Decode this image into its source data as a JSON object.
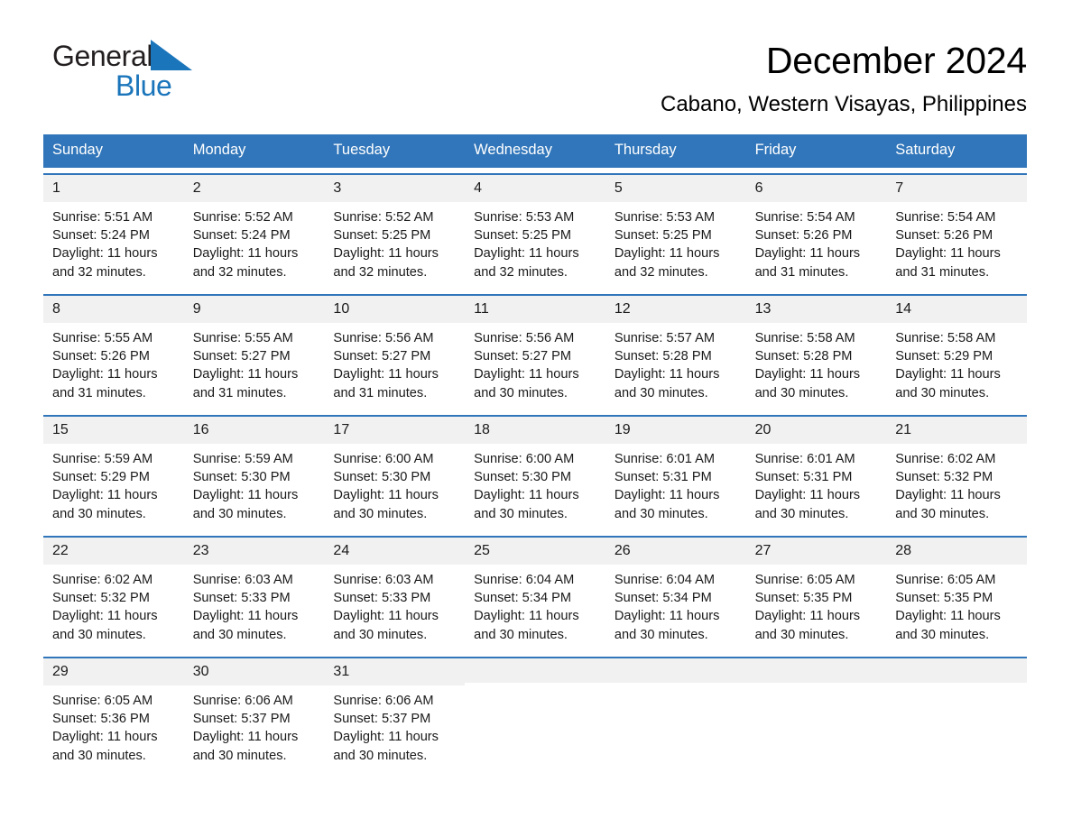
{
  "brand": {
    "name_line1": "General",
    "name_line2": "Blue",
    "accent_color": "#1b75bb",
    "triangle_icon": "triangle-icon"
  },
  "header": {
    "title": "December 2024",
    "subtitle": "Cabano, Western Visayas, Philippines"
  },
  "calendar": {
    "header_bg": "#3176ba",
    "header_text_color": "#ffffff",
    "row_divider_color": "#3176ba",
    "day_number_bg": "#f1f1f1",
    "weekdays": [
      "Sunday",
      "Monday",
      "Tuesday",
      "Wednesday",
      "Thursday",
      "Friday",
      "Saturday"
    ],
    "weeks": [
      [
        {
          "day": "1",
          "sunrise": "Sunrise: 5:51 AM",
          "sunset": "Sunset: 5:24 PM",
          "daylight_l1": "Daylight: 11 hours",
          "daylight_l2": "and 32 minutes."
        },
        {
          "day": "2",
          "sunrise": "Sunrise: 5:52 AM",
          "sunset": "Sunset: 5:24 PM",
          "daylight_l1": "Daylight: 11 hours",
          "daylight_l2": "and 32 minutes."
        },
        {
          "day": "3",
          "sunrise": "Sunrise: 5:52 AM",
          "sunset": "Sunset: 5:25 PM",
          "daylight_l1": "Daylight: 11 hours",
          "daylight_l2": "and 32 minutes."
        },
        {
          "day": "4",
          "sunrise": "Sunrise: 5:53 AM",
          "sunset": "Sunset: 5:25 PM",
          "daylight_l1": "Daylight: 11 hours",
          "daylight_l2": "and 32 minutes."
        },
        {
          "day": "5",
          "sunrise": "Sunrise: 5:53 AM",
          "sunset": "Sunset: 5:25 PM",
          "daylight_l1": "Daylight: 11 hours",
          "daylight_l2": "and 32 minutes."
        },
        {
          "day": "6",
          "sunrise": "Sunrise: 5:54 AM",
          "sunset": "Sunset: 5:26 PM",
          "daylight_l1": "Daylight: 11 hours",
          "daylight_l2": "and 31 minutes."
        },
        {
          "day": "7",
          "sunrise": "Sunrise: 5:54 AM",
          "sunset": "Sunset: 5:26 PM",
          "daylight_l1": "Daylight: 11 hours",
          "daylight_l2": "and 31 minutes."
        }
      ],
      [
        {
          "day": "8",
          "sunrise": "Sunrise: 5:55 AM",
          "sunset": "Sunset: 5:26 PM",
          "daylight_l1": "Daylight: 11 hours",
          "daylight_l2": "and 31 minutes."
        },
        {
          "day": "9",
          "sunrise": "Sunrise: 5:55 AM",
          "sunset": "Sunset: 5:27 PM",
          "daylight_l1": "Daylight: 11 hours",
          "daylight_l2": "and 31 minutes."
        },
        {
          "day": "10",
          "sunrise": "Sunrise: 5:56 AM",
          "sunset": "Sunset: 5:27 PM",
          "daylight_l1": "Daylight: 11 hours",
          "daylight_l2": "and 31 minutes."
        },
        {
          "day": "11",
          "sunrise": "Sunrise: 5:56 AM",
          "sunset": "Sunset: 5:27 PM",
          "daylight_l1": "Daylight: 11 hours",
          "daylight_l2": "and 30 minutes."
        },
        {
          "day": "12",
          "sunrise": "Sunrise: 5:57 AM",
          "sunset": "Sunset: 5:28 PM",
          "daylight_l1": "Daylight: 11 hours",
          "daylight_l2": "and 30 minutes."
        },
        {
          "day": "13",
          "sunrise": "Sunrise: 5:58 AM",
          "sunset": "Sunset: 5:28 PM",
          "daylight_l1": "Daylight: 11 hours",
          "daylight_l2": "and 30 minutes."
        },
        {
          "day": "14",
          "sunrise": "Sunrise: 5:58 AM",
          "sunset": "Sunset: 5:29 PM",
          "daylight_l1": "Daylight: 11 hours",
          "daylight_l2": "and 30 minutes."
        }
      ],
      [
        {
          "day": "15",
          "sunrise": "Sunrise: 5:59 AM",
          "sunset": "Sunset: 5:29 PM",
          "daylight_l1": "Daylight: 11 hours",
          "daylight_l2": "and 30 minutes."
        },
        {
          "day": "16",
          "sunrise": "Sunrise: 5:59 AM",
          "sunset": "Sunset: 5:30 PM",
          "daylight_l1": "Daylight: 11 hours",
          "daylight_l2": "and 30 minutes."
        },
        {
          "day": "17",
          "sunrise": "Sunrise: 6:00 AM",
          "sunset": "Sunset: 5:30 PM",
          "daylight_l1": "Daylight: 11 hours",
          "daylight_l2": "and 30 minutes."
        },
        {
          "day": "18",
          "sunrise": "Sunrise: 6:00 AM",
          "sunset": "Sunset: 5:30 PM",
          "daylight_l1": "Daylight: 11 hours",
          "daylight_l2": "and 30 minutes."
        },
        {
          "day": "19",
          "sunrise": "Sunrise: 6:01 AM",
          "sunset": "Sunset: 5:31 PM",
          "daylight_l1": "Daylight: 11 hours",
          "daylight_l2": "and 30 minutes."
        },
        {
          "day": "20",
          "sunrise": "Sunrise: 6:01 AM",
          "sunset": "Sunset: 5:31 PM",
          "daylight_l1": "Daylight: 11 hours",
          "daylight_l2": "and 30 minutes."
        },
        {
          "day": "21",
          "sunrise": "Sunrise: 6:02 AM",
          "sunset": "Sunset: 5:32 PM",
          "daylight_l1": "Daylight: 11 hours",
          "daylight_l2": "and 30 minutes."
        }
      ],
      [
        {
          "day": "22",
          "sunrise": "Sunrise: 6:02 AM",
          "sunset": "Sunset: 5:32 PM",
          "daylight_l1": "Daylight: 11 hours",
          "daylight_l2": "and 30 minutes."
        },
        {
          "day": "23",
          "sunrise": "Sunrise: 6:03 AM",
          "sunset": "Sunset: 5:33 PM",
          "daylight_l1": "Daylight: 11 hours",
          "daylight_l2": "and 30 minutes."
        },
        {
          "day": "24",
          "sunrise": "Sunrise: 6:03 AM",
          "sunset": "Sunset: 5:33 PM",
          "daylight_l1": "Daylight: 11 hours",
          "daylight_l2": "and 30 minutes."
        },
        {
          "day": "25",
          "sunrise": "Sunrise: 6:04 AM",
          "sunset": "Sunset: 5:34 PM",
          "daylight_l1": "Daylight: 11 hours",
          "daylight_l2": "and 30 minutes."
        },
        {
          "day": "26",
          "sunrise": "Sunrise: 6:04 AM",
          "sunset": "Sunset: 5:34 PM",
          "daylight_l1": "Daylight: 11 hours",
          "daylight_l2": "and 30 minutes."
        },
        {
          "day": "27",
          "sunrise": "Sunrise: 6:05 AM",
          "sunset": "Sunset: 5:35 PM",
          "daylight_l1": "Daylight: 11 hours",
          "daylight_l2": "and 30 minutes."
        },
        {
          "day": "28",
          "sunrise": "Sunrise: 6:05 AM",
          "sunset": "Sunset: 5:35 PM",
          "daylight_l1": "Daylight: 11 hours",
          "daylight_l2": "and 30 minutes."
        }
      ],
      [
        {
          "day": "29",
          "sunrise": "Sunrise: 6:05 AM",
          "sunset": "Sunset: 5:36 PM",
          "daylight_l1": "Daylight: 11 hours",
          "daylight_l2": "and 30 minutes."
        },
        {
          "day": "30",
          "sunrise": "Sunrise: 6:06 AM",
          "sunset": "Sunset: 5:37 PM",
          "daylight_l1": "Daylight: 11 hours",
          "daylight_l2": "and 30 minutes."
        },
        {
          "day": "31",
          "sunrise": "Sunrise: 6:06 AM",
          "sunset": "Sunset: 5:37 PM",
          "daylight_l1": "Daylight: 11 hours",
          "daylight_l2": "and 30 minutes."
        },
        {
          "day": "",
          "sunrise": "",
          "sunset": "",
          "daylight_l1": "",
          "daylight_l2": ""
        },
        {
          "day": "",
          "sunrise": "",
          "sunset": "",
          "daylight_l1": "",
          "daylight_l2": ""
        },
        {
          "day": "",
          "sunrise": "",
          "sunset": "",
          "daylight_l1": "",
          "daylight_l2": ""
        },
        {
          "day": "",
          "sunrise": "",
          "sunset": "",
          "daylight_l1": "",
          "daylight_l2": ""
        }
      ]
    ]
  }
}
